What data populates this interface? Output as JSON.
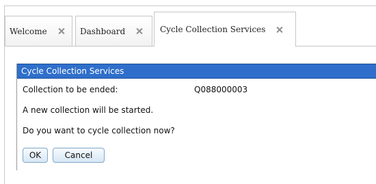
{
  "tabs": [
    {
      "label": "Welcome"
    },
    {
      "label": "Dashboard"
    },
    {
      "label": "Cycle Collection Services"
    }
  ],
  "dialog": {
    "title": "Cycle Collection Services",
    "collection_label": "Collection to be ended:",
    "collection_value": "Q088000003",
    "message1": "A new collection will be started.",
    "message2": "Do you want to cycle collection now?",
    "ok_label": "OK",
    "cancel_label": "Cancel"
  }
}
